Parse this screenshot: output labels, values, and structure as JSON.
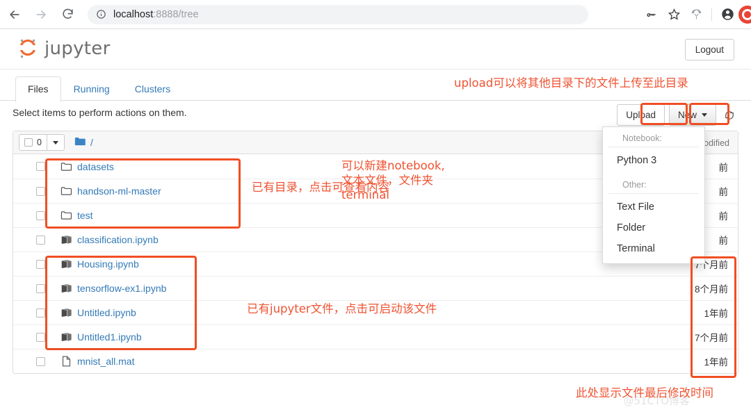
{
  "browser": {
    "back_icon": "back-arrow-icon",
    "forward_icon": "forward-arrow-icon",
    "reload_icon": "reload-icon",
    "info_icon": "info-circle-icon",
    "url_host": "localhost",
    "url_rest": ":8888/tree",
    "toolbar_icons": [
      "key-icon",
      "star-icon",
      "parachute-icon",
      "profile-avatar-icon"
    ]
  },
  "jupyter": {
    "brand": "jupyter",
    "logout_label": "Logout",
    "tabs": [
      {
        "label": "Files",
        "active": true
      },
      {
        "label": "Running",
        "active": false
      },
      {
        "label": "Clusters",
        "active": false
      }
    ],
    "select_note": "Select items to perform actions on them.",
    "upload_label": "Upload",
    "new_label": "New",
    "refresh_icon": "refresh-icon",
    "list_toolbar": {
      "selected_count": "0",
      "breadcrumb": "/",
      "folder_icon": "folder-icon",
      "last_modified_header": "Last Modified"
    },
    "new_menu": {
      "notebook_header": "Notebook:",
      "notebook_items": [
        "Python 3"
      ],
      "other_header": "Other:",
      "other_items": [
        "Text File",
        "Folder",
        "Terminal"
      ]
    },
    "files": [
      {
        "name": "datasets",
        "type": "folder",
        "icon": "folder-outline-icon",
        "modified": ""
      },
      {
        "name": "handson-ml-master",
        "type": "folder",
        "icon": "folder-outline-icon",
        "modified": ""
      },
      {
        "name": "test",
        "type": "folder",
        "icon": "folder-outline-icon",
        "modified": ""
      },
      {
        "name": "classification.ipynb",
        "type": "notebook",
        "icon": "notebook-icon",
        "modified": ""
      },
      {
        "name": "Housing.ipynb",
        "type": "notebook",
        "icon": "notebook-icon",
        "modified": "7个月前"
      },
      {
        "name": "tensorflow-ex1.ipynb",
        "type": "notebook",
        "icon": "notebook-icon",
        "modified": "8个月前"
      },
      {
        "name": "Untitled.ipynb",
        "type": "notebook",
        "icon": "notebook-icon",
        "modified": "1年前"
      },
      {
        "name": "Untitled1.ipynb",
        "type": "notebook",
        "icon": "notebook-icon",
        "modified": "7个月前"
      },
      {
        "name": "mnist_all.mat",
        "type": "file",
        "icon": "file-icon",
        "modified": "1年前"
      }
    ],
    "obscured_time_marks": [
      "前",
      "前",
      "前",
      "前"
    ]
  },
  "annotations": {
    "upload_note": "upload可以将其他目录下的文件上传至此目录",
    "folders_note": "已有目录，点击可查看内容",
    "new_note_line1": "可以新建notebook,",
    "new_note_line2": "文本文件，文件夹",
    "new_note_line3": "terminal",
    "notebooks_note": "已有jupyter文件，点击可启动该文件",
    "modified_note": "此处显示文件最后修改时间",
    "watermark": "@51CTO博客",
    "color": "#ef5332"
  }
}
